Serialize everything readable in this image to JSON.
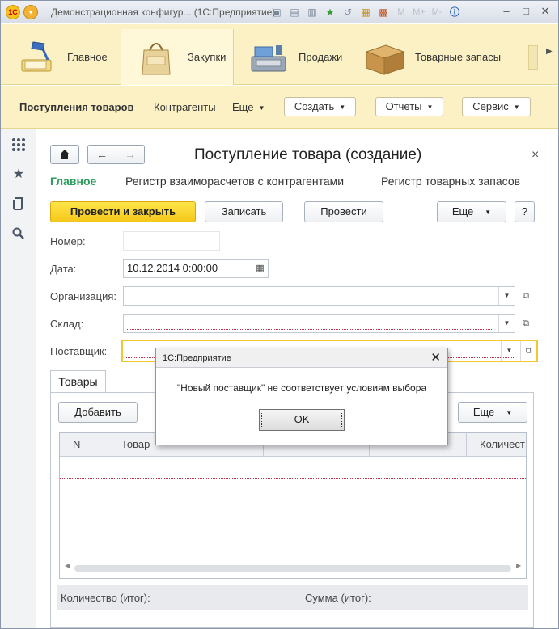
{
  "titlebar": {
    "title": "Демонстрационная конфигур... (1С:Предприятие)",
    "logo_text": "1С"
  },
  "sections": [
    {
      "label": "Главное",
      "icon": "desk-lamp-icon"
    },
    {
      "label": "Закупки",
      "icon": "shopping-bag-icon"
    },
    {
      "label": "Продажи",
      "icon": "cash-register-icon"
    },
    {
      "label": "Товарные запасы",
      "icon": "cardboard-box-icon"
    }
  ],
  "commands": {
    "incoming": "Поступления товаров",
    "counterparties": "Контрагенты",
    "more": "Еще",
    "create": "Создать",
    "reports": "Отчеты",
    "service": "Сервис"
  },
  "form": {
    "title": "Поступление товара (создание)",
    "tabs": [
      "Главное",
      "Регистр взаиморасчетов с контрагентами",
      "Регистр товарных запасов"
    ],
    "buttons": {
      "post_close": "Провести и закрыть",
      "save": "Записать",
      "post": "Провести",
      "more": "Еще",
      "help": "?"
    },
    "fields": {
      "number_label": "Номер:",
      "number_value": "",
      "date_label": "Дата:",
      "date_value": "10.12.2014  0:00:00",
      "org_label": "Организация:",
      "org_value": "",
      "warehouse_label": "Склад:",
      "warehouse_value": "",
      "supplier_label": "Поставщик:",
      "supplier_value": ""
    },
    "goods": {
      "tab_label": "Товары",
      "add_button": "Добавить",
      "more_button": "Еще",
      "columns": [
        "N",
        "Товар",
        "",
        "",
        "Количест"
      ],
      "total_qty_label": "Количество (итог):",
      "total_sum_label": "Сумма (итог):"
    }
  },
  "dialog": {
    "title": "1С:Предприятие",
    "message": "\"Новый поставщик\" не соответствует условиям выбора",
    "ok": "OK"
  }
}
